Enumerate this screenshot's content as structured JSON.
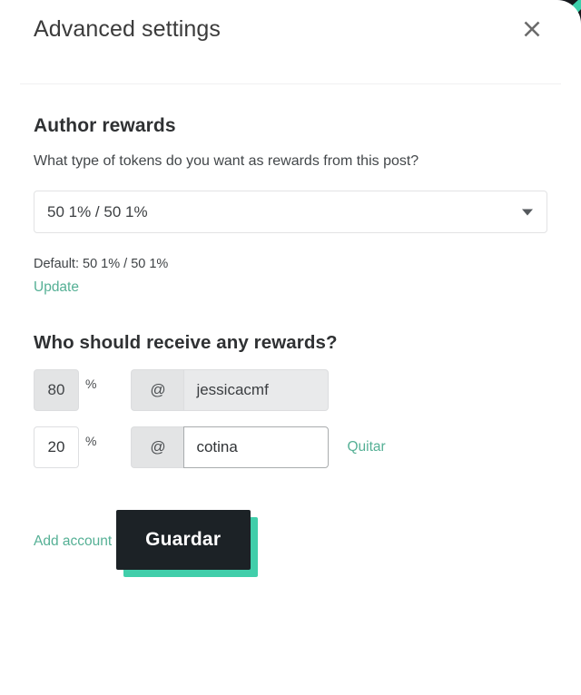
{
  "modal": {
    "title": "Advanced settings",
    "close_icon": "close-icon"
  },
  "author_rewards": {
    "heading": "Author rewards",
    "description": "What type of tokens do you want as rewards from this post?",
    "selected_option": "50 1% / 50 1%",
    "options": [
      "50 1% / 50 1%"
    ],
    "caret_icon": "chevron-down-icon",
    "default_text": "Default: 50 1% / 50 1%",
    "update_label": "Update"
  },
  "beneficiaries": {
    "heading": "Who should receive any rewards?",
    "percent_sign": "%",
    "at_symbol": "@",
    "username_placeholder": "username",
    "rows": [
      {
        "percent": "80",
        "username": "jessicacmf",
        "disabled": true,
        "remove_label": ""
      },
      {
        "percent": "20",
        "username": "cotina",
        "disabled": false,
        "remove_label": "Quitar"
      }
    ],
    "add_account_label": "Add account"
  },
  "footer": {
    "save_label": "Guardar"
  },
  "colors": {
    "accent_teal": "#41ceaa",
    "link_teal": "#55b095",
    "button_dark": "#1c2226",
    "text_primary": "#2f3133",
    "text_secondary": "#43474a"
  }
}
